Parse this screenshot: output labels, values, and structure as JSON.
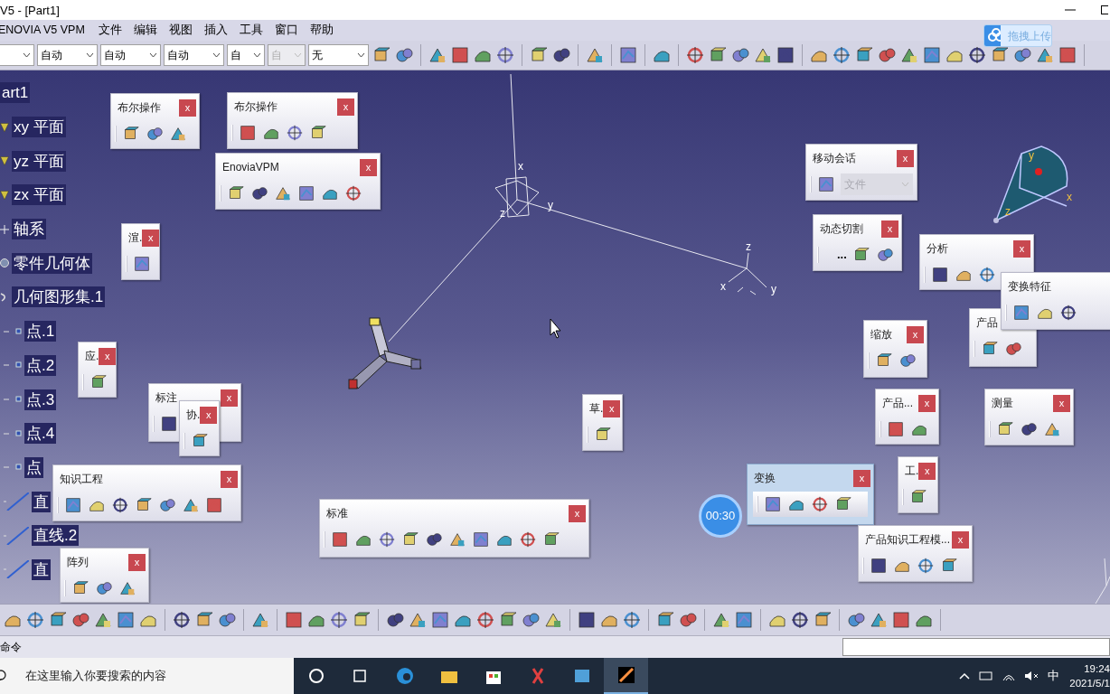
{
  "window": {
    "title": "V5 - [Part1]"
  },
  "menu": [
    "ENOVIA V5 VPM",
    "文件",
    "编辑",
    "视图",
    "插入",
    "工具",
    "窗口",
    "帮助"
  ],
  "upload_button": {
    "label": "拖拽上传"
  },
  "combos": [
    {
      "value": "自动",
      "disabled": false
    },
    {
      "value": "自动",
      "disabled": false
    },
    {
      "value": "自动",
      "disabled": false
    },
    {
      "value": "自",
      "disabled": false
    },
    {
      "value": "自",
      "disabled": true
    },
    {
      "value": "无",
      "disabled": false
    }
  ],
  "tree": {
    "label": "art1",
    "children": [
      {
        "label": "xy 平面",
        "kind": "plane"
      },
      {
        "label": "yz 平面",
        "kind": "plane"
      },
      {
        "label": "zx 平面",
        "kind": "plane"
      },
      {
        "label": "轴系",
        "kind": "axis"
      },
      {
        "label": "零件几何体",
        "kind": "body"
      },
      {
        "label": "几何图形集.1",
        "kind": "set",
        "children": [
          {
            "label": "点.1",
            "kind": "point"
          },
          {
            "label": "点.2",
            "kind": "point"
          },
          {
            "label": "点.3",
            "kind": "point"
          },
          {
            "label": "点.4",
            "kind": "point"
          },
          {
            "label": "点",
            "kind": "point"
          },
          {
            "label": "直",
            "kind": "line"
          },
          {
            "label": "直线.2",
            "kind": "line"
          },
          {
            "label": "直",
            "kind": "line"
          }
        ]
      }
    ]
  },
  "viewport": {
    "axis_labels": [
      "x",
      "y",
      "z",
      "z",
      "x",
      "y",
      "y",
      "x",
      "z"
    ],
    "timer": "00:30"
  },
  "toolbars": [
    {
      "title": "布尔操作",
      "close": "x",
      "active": false
    },
    {
      "title": "布尔操作",
      "close": "x",
      "active": false
    },
    {
      "title": "EnoviaVPM",
      "close": "x",
      "active": false
    },
    {
      "title": "渲.",
      "close": "x",
      "active": false
    },
    {
      "title": "应.",
      "close": "x",
      "active": false
    },
    {
      "title": "标注",
      "close": "x",
      "active": false
    },
    {
      "title": "协.",
      "close": "x",
      "active": false
    },
    {
      "title": "知识工程",
      "close": "x",
      "active": false
    },
    {
      "title": "阵列",
      "close": "x",
      "active": false
    },
    {
      "title": "标准",
      "close": "x",
      "active": false
    },
    {
      "title": "草.",
      "close": "x",
      "active": false
    },
    {
      "title": "移动会话",
      "close": "x",
      "active": false,
      "combo": {
        "value": "文件",
        "disabled": true
      }
    },
    {
      "title": "动态切割",
      "close": "x",
      "active": false,
      "prefix": "..."
    },
    {
      "title": "分析",
      "close": "x",
      "active": false
    },
    {
      "title": "产品",
      "active": false
    },
    {
      "title": "变换特征",
      "active": false
    },
    {
      "title": "缩放",
      "close": "x",
      "active": false
    },
    {
      "title": "产品...",
      "close": "x",
      "active": false
    },
    {
      "title": "测量",
      "close": "x",
      "active": false
    },
    {
      "title": "变换",
      "close": "x",
      "active": true
    },
    {
      "title": "工.",
      "close": "x",
      "active": false
    },
    {
      "title": "产品知识工程模...",
      "close": "x",
      "active": false
    }
  ],
  "status_bar": {
    "text": "命令"
  },
  "taskbar": {
    "search_placeholder": "在这里输入你要搜索的内容",
    "ime": "中",
    "time": "19:24",
    "date": "2021/5/1"
  }
}
